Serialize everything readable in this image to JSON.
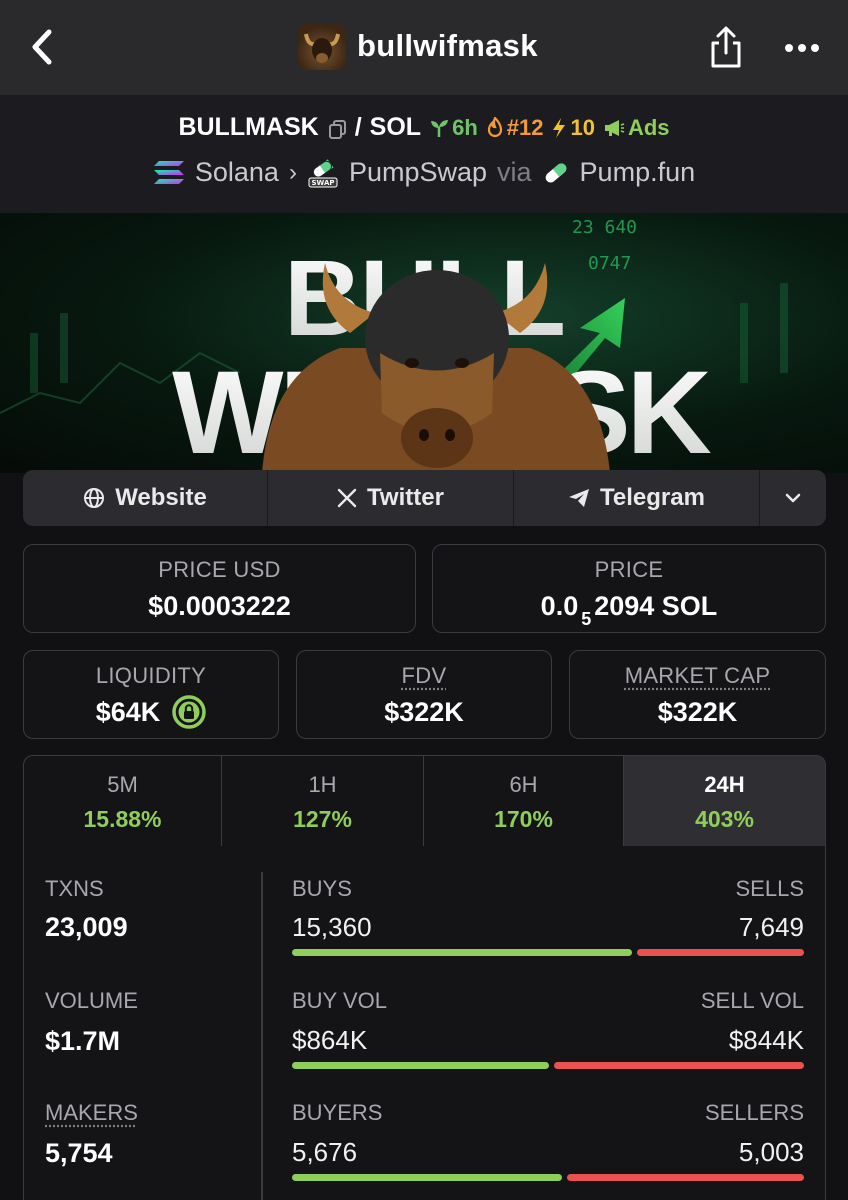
{
  "nav": {
    "title": "bullwifmask"
  },
  "pair": {
    "base": "BULLMASK",
    "separator": "/",
    "quote": "SOL",
    "age": "6h",
    "trending_rank": "#12",
    "boosts": "10",
    "ads": "Ads",
    "chain": "Solana",
    "dex": "PumpSwap",
    "via": "via",
    "launchpad": "Pump.fun"
  },
  "banner": {
    "line1": "BULL",
    "line2": "WIFMASK",
    "ticker_a": "23 640",
    "ticker_b": "0747"
  },
  "social": {
    "website": "Website",
    "twitter": "Twitter",
    "telegram": "Telegram"
  },
  "prices": {
    "usd_label": "PRICE USD",
    "usd_value": "$0.0003222",
    "sol_label": "PRICE",
    "sol_value_prefix": "0.0",
    "sol_value_sub": "5",
    "sol_value_suffix": "2094 SOL"
  },
  "metrics": {
    "liquidity_label": "LIQUIDITY",
    "liquidity_value": "$64K",
    "fdv_label": "FDV",
    "fdv_value": "$322K",
    "mcap_label": "MARKET CAP",
    "mcap_value": "$322K"
  },
  "timeframes": [
    {
      "label": "5M",
      "change": "15.88%"
    },
    {
      "label": "1H",
      "change": "127%"
    },
    {
      "label": "6H",
      "change": "170%"
    },
    {
      "label": "24H",
      "change": "403%"
    }
  ],
  "stats": {
    "txns_label": "TXNS",
    "txns_value": "23,009",
    "volume_label": "VOLUME",
    "volume_value": "$1.7M",
    "makers_label": "MAKERS",
    "makers_value": "5,754",
    "buys_label": "BUYS",
    "buys_value": "15,360",
    "sells_label": "SELLS",
    "sells_value": "7,649",
    "buy_share": 0.668,
    "buyvol_label": "BUY VOL",
    "buyvol_value": "$864K",
    "sellvol_label": "SELL VOL",
    "sellvol_value": "$844K",
    "buyvol_share": 0.506,
    "buyers_label": "BUYERS",
    "buyers_value": "5,676",
    "sellers_label": "SELLERS",
    "sellers_value": "5,003",
    "buyers_share": 0.531
  },
  "colors": {
    "positive": "#8fce5a",
    "negative": "#e9534f",
    "background": "#111114"
  }
}
